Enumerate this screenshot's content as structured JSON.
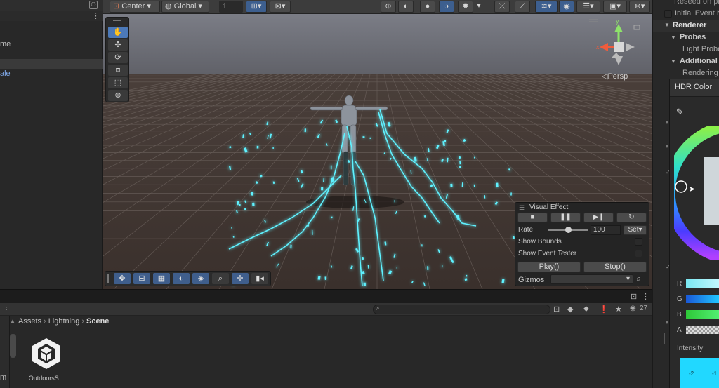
{
  "hierarchy": {
    "items": [
      "me",
      "ale"
    ]
  },
  "scene_toolbar": {
    "pivot_mode": "Center",
    "space_mode": "Global",
    "grid_value": "1"
  },
  "scene_view": {
    "camera_label": "Persp",
    "gizmo_x_label": "x",
    "gizmo_y_label": "y"
  },
  "visual_effect": {
    "title": "Visual Effect",
    "rate_label": "Rate",
    "rate_value": "100",
    "rate_fraction": 0.5,
    "set_label": "Set",
    "show_bounds_label": "Show Bounds",
    "show_event_tester_label": "Show Event Tester",
    "play_label": "Play()",
    "stop_label": "Stop()",
    "gizmos_label": "Gizmos"
  },
  "project": {
    "breadcrumb": [
      "Assets",
      "Lightning",
      "Scene"
    ],
    "asset_name": "OutdoorsS...",
    "left_fragment": "m",
    "visible_count": "27"
  },
  "inspector": {
    "reseed_label": "Reseed on pla",
    "initial_event_label": "Initial Event N",
    "renderer_label": "Renderer",
    "probes_label": "Probes",
    "light_probes_label": "Light Probe",
    "additional_label": "Additional S",
    "rendering_label": "Rendering"
  },
  "color_picker": {
    "title": "HDR Color",
    "channels": [
      "R",
      "G",
      "B",
      "A"
    ],
    "intensity_label": "Intensity",
    "intensity_ticks": [
      "-2",
      "-1"
    ]
  },
  "colors": {
    "accent_blue": "#4c79b8",
    "lightning_cyan": "#5ff2ff",
    "ground": "#3f3531"
  }
}
